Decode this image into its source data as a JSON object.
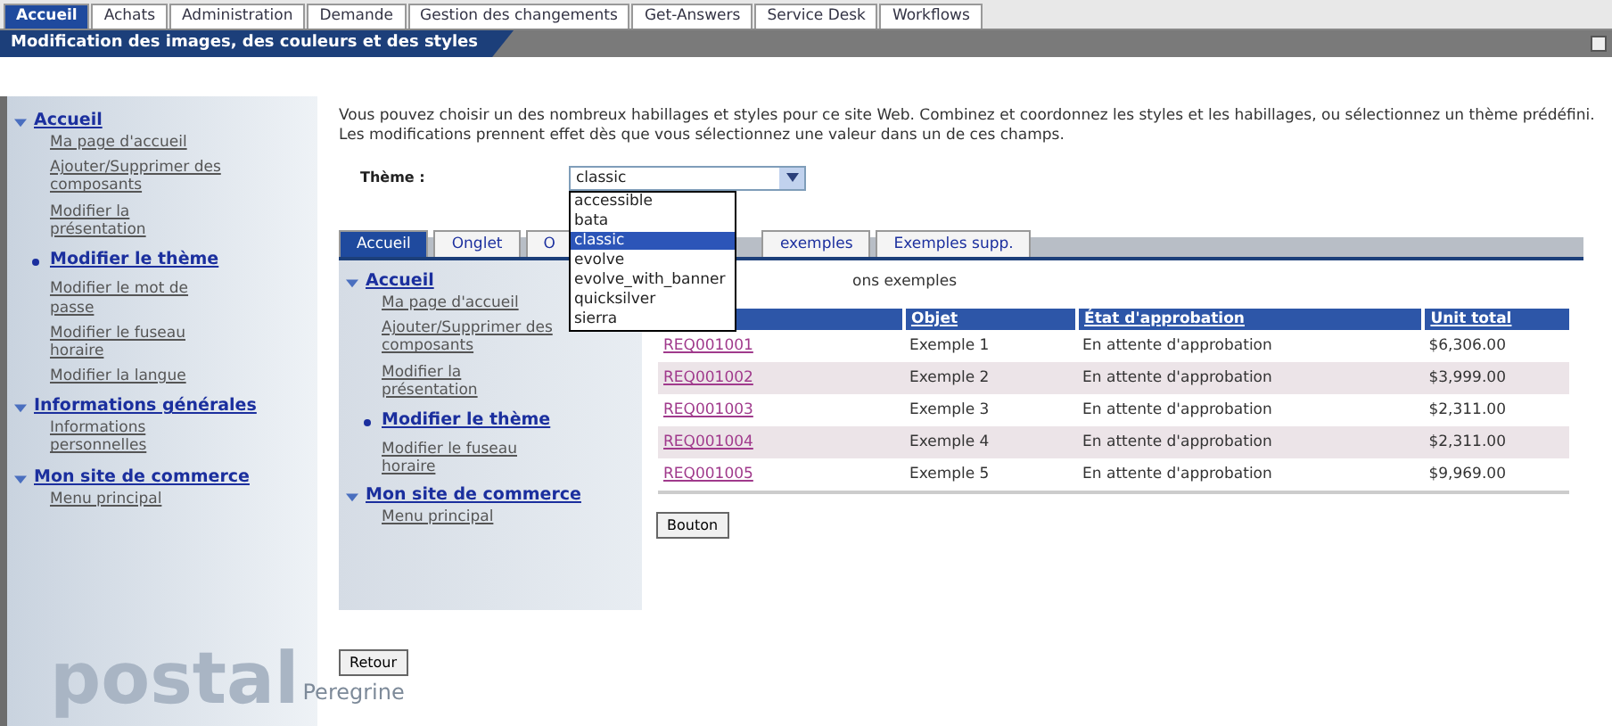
{
  "top_tabs": [
    {
      "label": "Accueil",
      "selected": true
    },
    {
      "label": "Achats",
      "selected": false
    },
    {
      "label": "Administration",
      "selected": false
    },
    {
      "label": "Demande",
      "selected": false
    },
    {
      "label": "Gestion des changements",
      "selected": false
    },
    {
      "label": "Get-Answers",
      "selected": false
    },
    {
      "label": "Service Desk",
      "selected": false
    },
    {
      "label": "Workflows",
      "selected": false
    }
  ],
  "page_title": "Modification des images, des couleurs et des styles",
  "sidebar": {
    "items": [
      {
        "label": "Accueil",
        "expanded": true,
        "children": [
          {
            "label": "Ma page d'accueil",
            "selected": false
          },
          {
            "label": "Ajouter/Supprimer des composants",
            "selected": false
          },
          {
            "label": "Modifier la présentation",
            "selected": false
          },
          {
            "label": "Modifier le thème",
            "selected": true
          },
          {
            "label": "Modifier le mot de passe",
            "selected": false
          },
          {
            "label": "Modifier le fuseau horaire",
            "selected": false
          },
          {
            "label": "Modifier la langue",
            "selected": false
          }
        ]
      },
      {
        "label": "Informations générales",
        "expanded": true,
        "children": [
          {
            "label": "Informations personnelles",
            "selected": false
          }
        ]
      },
      {
        "label": "Mon site de commerce",
        "expanded": true,
        "children": [
          {
            "label": "Menu principal",
            "selected": false
          }
        ]
      }
    ],
    "logo": {
      "big": "postal",
      "small": "Peregrine"
    }
  },
  "intro": "Vous pouvez choisir un des nombreux habillages et styles pour ce site Web. Combinez et coordonnez les styles et les habillages, ou sélectionnez un thème prédéfini. Les modifications prennent effet dès que vous sélectionnez une valeur dans un de ces champs.",
  "theme_field": {
    "label": "Thème :",
    "value": "classic",
    "expanded": true,
    "options": [
      {
        "label": "accessible",
        "selected": false
      },
      {
        "label": "bata",
        "selected": false
      },
      {
        "label": "classic",
        "selected": true
      },
      {
        "label": "evolve",
        "selected": false
      },
      {
        "label": "evolve_with_banner",
        "selected": false
      },
      {
        "label": "quicksilver",
        "selected": false
      },
      {
        "label": "sierra",
        "selected": false
      }
    ]
  },
  "preview": {
    "tabs": [
      {
        "label": "Accueil",
        "selected": true
      },
      {
        "label": "Onglet",
        "selected": false
      },
      {
        "label": "O",
        "selected": false
      },
      {
        "label": "exemples",
        "selected": false
      },
      {
        "label": "Exemples supp.",
        "selected": false
      }
    ],
    "sidebar": {
      "items": [
        {
          "label": "Accueil",
          "children": [
            {
              "label": "Ma page d'accueil",
              "selected": false
            },
            {
              "label": "Ajouter/Supprimer des composants",
              "selected": false
            },
            {
              "label": "Modifier la présentation",
              "selected": false
            },
            {
              "label": "Modifier le thème",
              "selected": true
            },
            {
              "label": "Modifier le fuseau horaire",
              "selected": false
            }
          ]
        },
        {
          "label": "Mon site de commerce",
          "children": [
            {
              "label": "Menu principal",
              "selected": false
            }
          ]
        }
      ]
    },
    "caption": "ons exemples",
    "table": {
      "columns": [
        "",
        "Objet",
        "État d'approbation",
        "Unit total"
      ],
      "rows": [
        {
          "id": "REQ001001",
          "object": "Exemple 1",
          "status": "En attente d'approbation",
          "total": "$6,306.00"
        },
        {
          "id": "REQ001002",
          "object": "Exemple 2",
          "status": "En attente d'approbation",
          "total": "$3,999.00"
        },
        {
          "id": "REQ001003",
          "object": "Exemple 3",
          "status": "En attente d'approbation",
          "total": "$2,311.00"
        },
        {
          "id": "REQ001004",
          "object": "Exemple 4",
          "status": "En attente d'approbation",
          "total": "$2,311.00"
        },
        {
          "id": "REQ001005",
          "object": "Exemple 5",
          "status": "En attente d'approbation",
          "total": "$9,969.00"
        }
      ]
    },
    "button": "Bouton"
  },
  "back_button": "Retour"
}
